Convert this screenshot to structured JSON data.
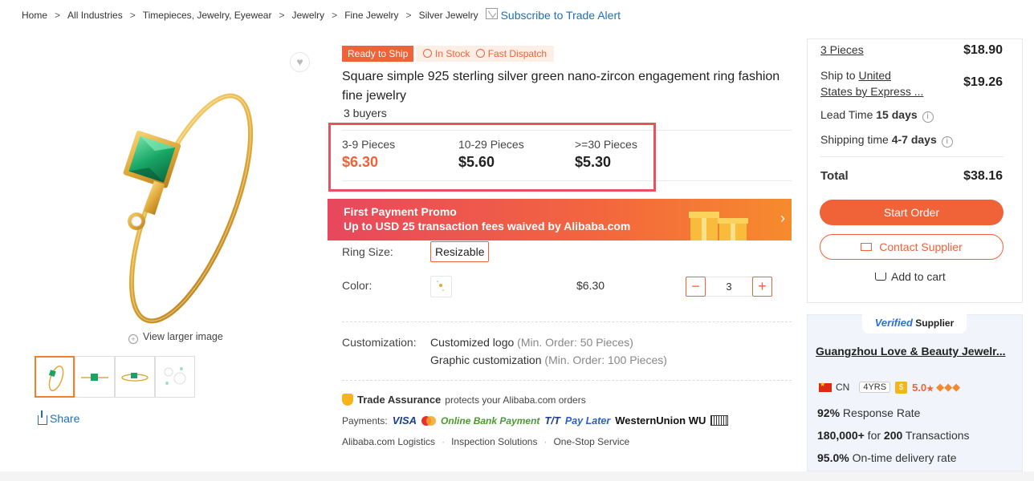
{
  "breadcrumb": {
    "items": [
      "Home",
      "All Industries",
      "Timepieces, Jewelry, Eyewear",
      "Jewelry",
      "Fine Jewelry",
      "Silver Jewelry"
    ],
    "separator": ">",
    "subscribe_label": "Subscribe to Trade Alert"
  },
  "gallery": {
    "view_larger_label": "View larger image",
    "share_label": "Share",
    "thumb_count": 4
  },
  "product": {
    "badge_ready": "Ready to Ship",
    "badge_in_stock": "In Stock",
    "badge_fast_dispatch": "Fast Dispatch",
    "title": "Square simple 925 sterling silver green nano-zircon engagement ring fashion fine jewelry",
    "buyers": "3 buyers",
    "price_tiers": [
      {
        "qty": "3-9 Pieces",
        "price": "$6.30"
      },
      {
        "qty": "10-29 Pieces",
        "price": "$5.60"
      },
      {
        "qty": ">=30 Pieces",
        "price": "$5.30"
      }
    ]
  },
  "promo": {
    "line1": "First Payment Promo",
    "line2": "Up to USD 25 transaction fees waived by Alibaba.com",
    "arrow": "›"
  },
  "options": {
    "ring_size_label": "Ring Size:",
    "ring_size_value": "Resizable",
    "color_label": "Color:",
    "color_price": "$6.30",
    "quantity": "3",
    "minus": "−",
    "plus": "+"
  },
  "customization": {
    "label": "Customization:",
    "lines": [
      {
        "name": "Customized logo",
        "note": "(Min. Order: 50 Pieces)"
      },
      {
        "name": "Graphic customization",
        "note": "(Min. Order: 100 Pieces)"
      }
    ]
  },
  "trade_assurance": {
    "title": "Trade Assurance",
    "text": "protects your Alibaba.com orders",
    "payments_label": "Payments:",
    "payment_methods": [
      "VISA",
      "Online Bank Payment",
      "T/T",
      "Pay Later",
      "WesternUnion WU"
    ],
    "services": [
      "Alibaba.com Logistics",
      "Inspection Solutions",
      "One-Stop Service"
    ]
  },
  "order_panel": {
    "pieces_label": "3 Pieces",
    "pieces_price": "$18.90",
    "ship_prefix": "Ship to ",
    "ship_country": "United",
    "ship_line2": "States by Express ...",
    "ship_price": "$19.26",
    "lead_time_label": "Lead Time ",
    "lead_time_value": "15 days",
    "shipping_time_label": "Shipping time ",
    "shipping_time_value": "4-7 days",
    "total_label": "Total",
    "total_value": "$38.16",
    "start_order": "Start Order",
    "contact_supplier": "Contact Supplier",
    "add_to_cart": "Add to cart"
  },
  "supplier": {
    "verified": "Verified",
    "verified_suffix": "Supplier",
    "name": "Guangzhou Love & Beauty Jewelr...",
    "country": "CN",
    "years": "4YRS",
    "rating": "5.0",
    "rating_star": "★",
    "response_rate_value": "92%",
    "response_rate_label": " Response Rate",
    "transactions_value": "180,000+",
    "transactions_mid": " for ",
    "transactions_count": "200",
    "transactions_label": " Transactions",
    "ontime_value": "95.0%",
    "ontime_label": " On-time delivery rate"
  },
  "colors": {
    "accent": "#f06237",
    "link": "#1f6fb5",
    "highlight_box": "#e6535f"
  }
}
